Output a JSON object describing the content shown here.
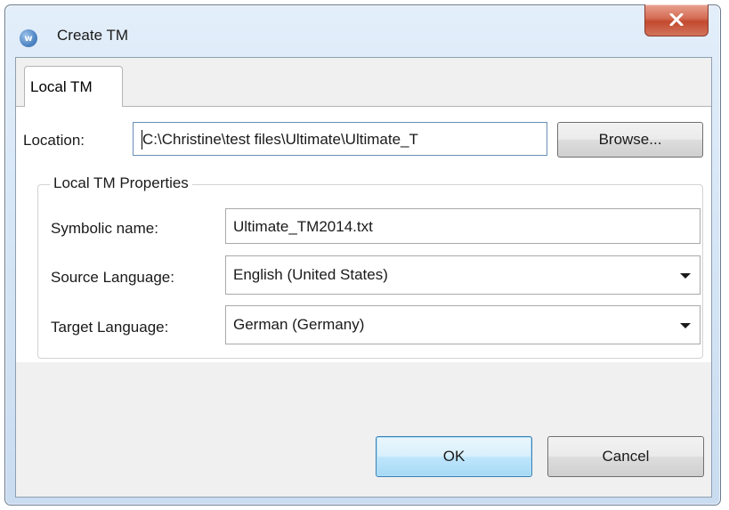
{
  "window": {
    "title": "Create TM",
    "app_icon": "wordfast-app-icon",
    "close_icon": "close-icon"
  },
  "tabs": [
    {
      "label": "Local TM",
      "selected": true
    }
  ],
  "location": {
    "label": "Location:",
    "value": "C:\\Christine\\test files\\Ultimate\\Ultimate_T",
    "browse_label": "Browse..."
  },
  "properties": {
    "legend": "Local TM Properties",
    "symbolic_name": {
      "label": "Symbolic name:",
      "value": "Ultimate_TM2014.txt"
    },
    "source_language": {
      "label": "Source Language:",
      "value": "English (United States)"
    },
    "target_language": {
      "label": "Target Language:",
      "value": "German (Germany)"
    }
  },
  "footer": {
    "ok_label": "OK",
    "cancel_label": "Cancel"
  }
}
